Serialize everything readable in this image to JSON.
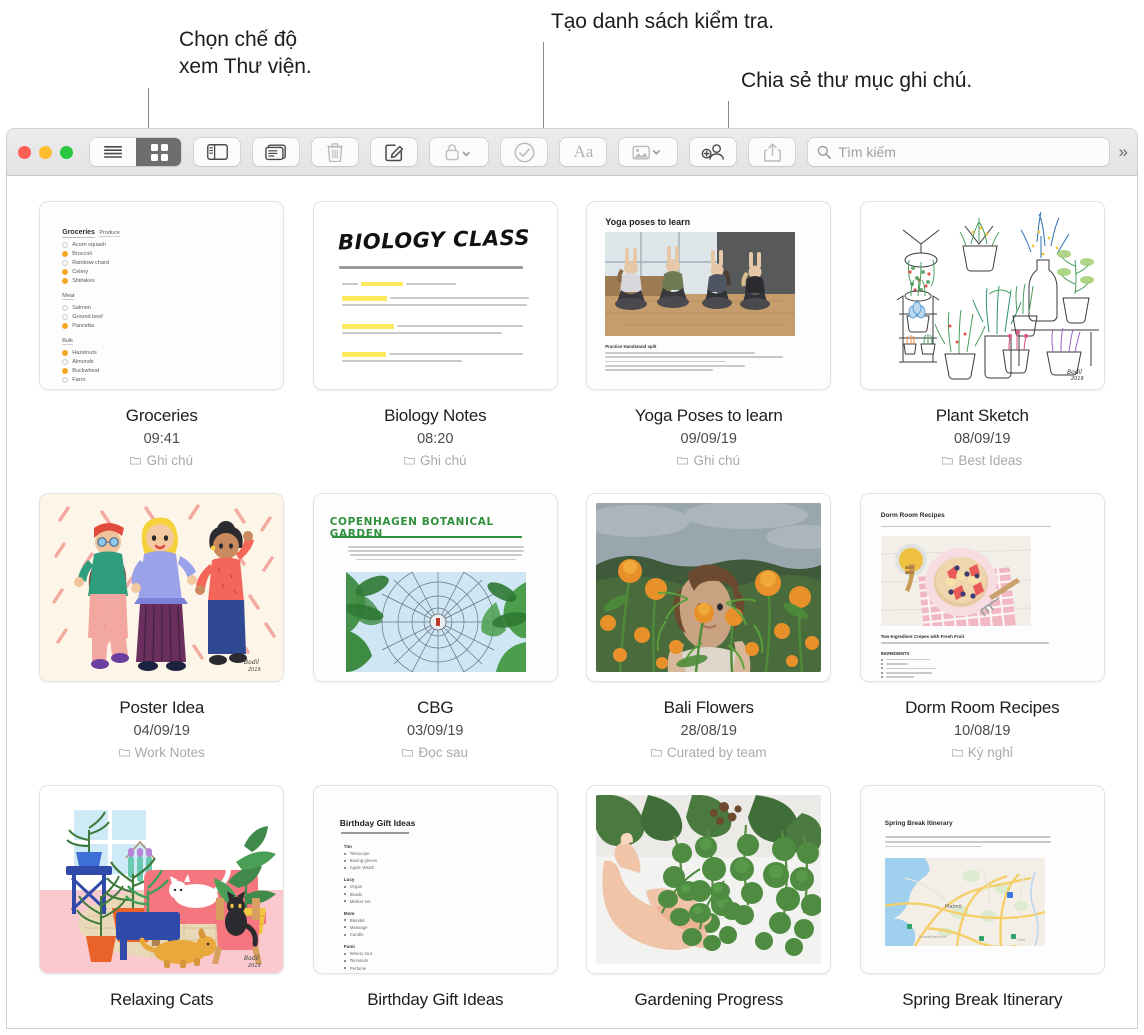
{
  "callouts": [
    {
      "text": "Chọn chế độ\nxem Thư viện.",
      "name": "callout-library-view"
    },
    {
      "text": "Tạo danh sách kiểm tra.",
      "name": "callout-checklist"
    },
    {
      "text": "Chia sẻ thư mục ghi chú.",
      "name": "callout-share-folder"
    }
  ],
  "toolbar": {
    "list_view": "list-view-icon",
    "grid_view": "grid-view-icon",
    "sidebar": "sidebar-icon",
    "gallery": "attachments-icon",
    "delete": "trash-icon",
    "compose": "compose-icon",
    "lock": "lock-icon",
    "checklist": "checklist-icon",
    "format": "Aa",
    "media": "media-icon",
    "share_folder": "add-person-icon",
    "share": "share-icon",
    "search_placeholder": "Tìm kiếm",
    "overflow": "»"
  },
  "notes": [
    {
      "title": "Groceries",
      "date": "09:41",
      "folder": "Ghi chú",
      "art": "groceries"
    },
    {
      "title": "Biology Notes",
      "date": "08:20",
      "folder": "Ghi chú",
      "art": "biology"
    },
    {
      "title": "Yoga Poses to learn",
      "date": "09/09/19",
      "folder": "Ghi chú",
      "art": "yoga"
    },
    {
      "title": "Plant Sketch",
      "date": "08/09/19",
      "folder": "Best Ideas",
      "art": "plants"
    },
    {
      "title": "Poster Idea",
      "date": "04/09/19",
      "folder": "Work Notes",
      "art": "poster"
    },
    {
      "title": "CBG",
      "date": "03/09/19",
      "folder": "Đọc sau",
      "art": "cbg"
    },
    {
      "title": "Bali Flowers",
      "date": "28/08/19",
      "folder": "Curated by team",
      "art": "bali"
    },
    {
      "title": "Dorm Room Recipes",
      "date": "10/08/19",
      "folder": "Kỳ nghỉ",
      "art": "recipes"
    },
    {
      "title": "Relaxing Cats",
      "date": "",
      "folder": "",
      "art": "cats"
    },
    {
      "title": "Birthday Gift Ideas",
      "date": "",
      "folder": "",
      "art": "gifts"
    },
    {
      "title": "Gardening Progress",
      "date": "",
      "folder": "",
      "art": "gardening"
    },
    {
      "title": "Spring Break Itinerary",
      "date": "",
      "folder": "",
      "art": "itinerary"
    }
  ],
  "art_text": {
    "groceries": {
      "heading": "Groceries",
      "sections": [
        {
          "name": "Produce",
          "items": [
            {
              "label": "Acorn squash",
              "checked": false
            },
            {
              "label": "Broccoli",
              "checked": true
            },
            {
              "label": "Rainbow chard",
              "checked": false
            },
            {
              "label": "Celery",
              "checked": true
            },
            {
              "label": "Shiitakes",
              "checked": true
            }
          ]
        },
        {
          "name": "Meat",
          "items": [
            {
              "label": "Salmon",
              "checked": false
            },
            {
              "label": "Ground beef",
              "checked": false
            },
            {
              "label": "Pancetta",
              "checked": true
            }
          ]
        },
        {
          "name": "Bulk",
          "items": [
            {
              "label": "Hazelnuts",
              "checked": true
            },
            {
              "label": "Almonds",
              "checked": false
            },
            {
              "label": "Buckwheat",
              "checked": true
            }
          ]
        }
      ]
    },
    "biology": {
      "heading": "BIOLOGY CLASS"
    },
    "yoga": {
      "heading": "Yoga poses to learn",
      "caption": "Practice Handstand split"
    },
    "cbg": {
      "heading": "COPENHAGEN BOTANICAL GARDEN"
    },
    "recipes": {
      "heading": "Dorm Room Recipes",
      "subheading": "Two-Ingredient Crepes with Fresh Fruit",
      "list_heading": "INGREDIENTS"
    },
    "gifts": {
      "heading": "Birthday Gift Ideas",
      "sections": [
        {
          "name": "Tim",
          "items": [
            "Telescope",
            "Boxing gloves",
            "Apple Watch"
          ]
        },
        {
          "name": "Lucy",
          "items": [
            "Vegan",
            "Beads",
            "Marker set"
          ]
        },
        {
          "name": "Mom",
          "items": [
            "Blender",
            "Massage",
            "Candle"
          ]
        },
        {
          "name": "Fumi",
          "items": [
            "Winery tour",
            "Terrarium",
            "Perfume"
          ]
        }
      ]
    },
    "itinerary": {
      "heading": "Spring Break Itinerary"
    }
  },
  "colors": {
    "accent_orange": "#f5a623",
    "toolbar_selected": "#6e6e6e",
    "highlight_yellow": "#ffe95c"
  }
}
